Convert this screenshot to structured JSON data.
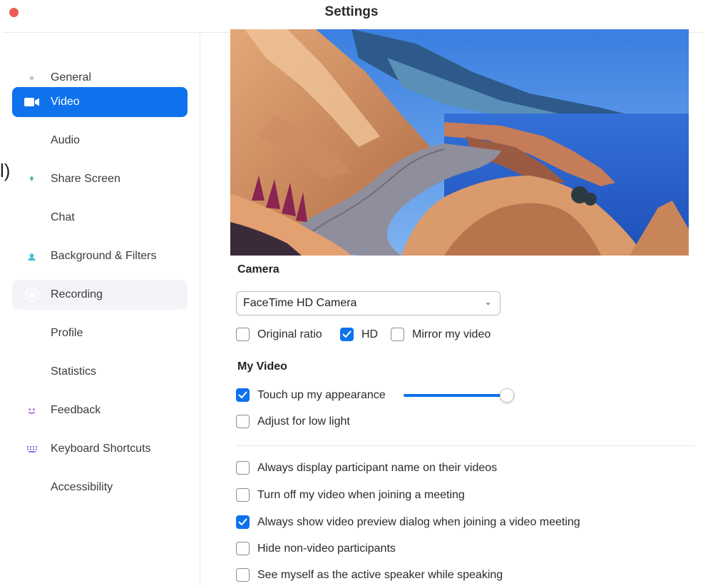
{
  "window": {
    "title": "Settings"
  },
  "stray_text": "l)",
  "sidebar": {
    "items": [
      {
        "label": "General",
        "icon": "gear-icon",
        "color": "#c8c8cc",
        "state": "normal"
      },
      {
        "label": "Video",
        "icon": "video-camera-icon",
        "color": "#0e72ed",
        "state": "active"
      },
      {
        "label": "Audio",
        "icon": "headphones-icon",
        "color": "#3fb36b",
        "state": "normal"
      },
      {
        "label": "Share Screen",
        "icon": "share-screen-icon",
        "color": "#3fb36b",
        "state": "normal"
      },
      {
        "label": "Chat",
        "icon": "chat-bubble-icon",
        "color": "#2fb4c9",
        "state": "normal"
      },
      {
        "label": "Background & Filters",
        "icon": "background-portrait-icon",
        "color": "#3fc2d4",
        "state": "normal"
      },
      {
        "label": "Recording",
        "icon": "record-icon",
        "color": "#2fa9e8",
        "state": "hover"
      },
      {
        "label": "Profile",
        "icon": "profile-person-icon",
        "color": "#2e8ef0",
        "state": "normal"
      },
      {
        "label": "Statistics",
        "icon": "bar-chart-icon",
        "color": "#b26ad6",
        "state": "normal"
      },
      {
        "label": "Feedback",
        "icon": "smiley-icon",
        "color": "#a05fdc",
        "state": "normal"
      },
      {
        "label": "Keyboard Shortcuts",
        "icon": "keyboard-icon",
        "color": "#8f62e0",
        "state": "normal"
      },
      {
        "label": "Accessibility",
        "icon": "accessibility-icon",
        "color": "#6f63e3",
        "state": "normal"
      }
    ]
  },
  "camera": {
    "heading": "Camera",
    "selected_camera": "FaceTime HD Camera",
    "options": [
      {
        "label": "Original ratio",
        "checked": false
      },
      {
        "label": "HD",
        "checked": true
      },
      {
        "label": "Mirror my video",
        "checked": false
      }
    ]
  },
  "my_video": {
    "heading": "My Video",
    "touch_up": {
      "label": "Touch up my appearance",
      "checked": true,
      "level_fraction": 0.93
    },
    "low_light": {
      "label": "Adjust for low light",
      "checked": false
    }
  },
  "general_options": [
    {
      "label": "Always display participant name on their videos",
      "checked": false
    },
    {
      "label": "Turn off my video when joining a meeting",
      "checked": false
    },
    {
      "label": "Always show video preview dialog when joining a video meeting",
      "checked": true
    },
    {
      "label": "Hide non-video participants",
      "checked": false
    },
    {
      "label": "See myself as the active speaker while speaking",
      "checked": false
    }
  ],
  "colors": {
    "accent": "#0e72ed",
    "close_button": "#ee5b56"
  }
}
